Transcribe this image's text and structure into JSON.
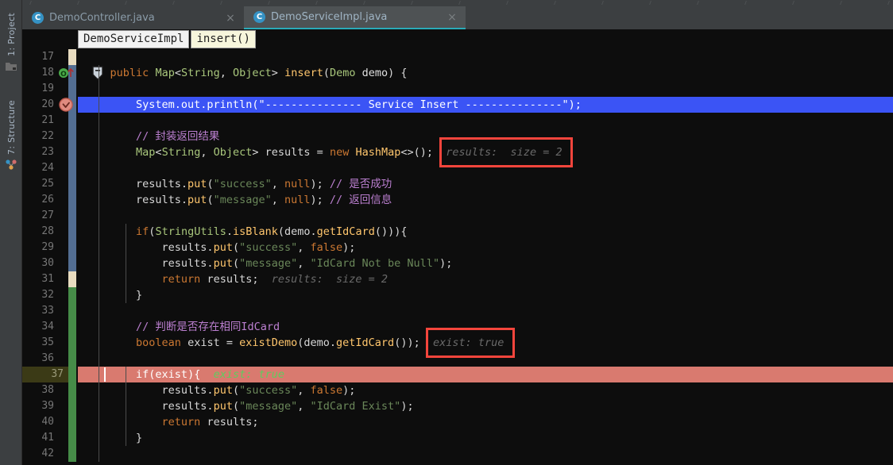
{
  "window": {
    "kind": "intellij-idea-java-editor-debug"
  },
  "sidebar": {
    "items": [
      {
        "label": "1: Project",
        "icon": "project-folder-icon"
      },
      {
        "label": "7: Structure",
        "icon": "structure-node-icon"
      }
    ]
  },
  "tabs": [
    {
      "label": "DemoController.java",
      "icon": "java-class-icon",
      "close": "×",
      "active": false
    },
    {
      "label": "DemoServiceImpl.java",
      "icon": "java-class-icon",
      "close": "×",
      "active": true
    }
  ],
  "breadcrumb": {
    "class_name": "DemoServiceImpl",
    "method_name": "insert()"
  },
  "gutter": {
    "first_line": 17,
    "last_line": 42,
    "breakpoint_line": 20,
    "override_marker_line": 18,
    "fold_marker_line": 18,
    "current_execution_line": 37,
    "breakpoint_icon": "breakpoint-verified-icon",
    "override_icon": "implements-method-icon",
    "fold_icon": "fold-collapse-icon"
  },
  "colors": {
    "selection_blue": "#3b54f5",
    "execution_salmon": "#d97a6f",
    "vcs_modified_blue": "#536e92",
    "vcs_added_green": "#468c48",
    "vcs_changed_tan": "#e8dcc0",
    "debug_box_red": "#f4453c",
    "tab_accent": "#2aabb8"
  },
  "code_lines": [
    {
      "n": 17,
      "tokens": []
    },
    {
      "n": 18,
      "tokens": [
        {
          "t": "    ",
          "c": "plain"
        },
        {
          "t": "public",
          "c": "kw"
        },
        {
          "t": " ",
          "c": "plain"
        },
        {
          "t": "Map",
          "c": "type"
        },
        {
          "t": "<",
          "c": "plain"
        },
        {
          "t": "String",
          "c": "type"
        },
        {
          "t": ", ",
          "c": "plain"
        },
        {
          "t": "Object",
          "c": "type"
        },
        {
          "t": "> ",
          "c": "plain"
        },
        {
          "t": "insert",
          "c": "mth"
        },
        {
          "t": "(",
          "c": "plain"
        },
        {
          "t": "Demo",
          "c": "type"
        },
        {
          "t": " ",
          "c": "plain"
        },
        {
          "t": "demo",
          "c": "fld"
        },
        {
          "t": ") {",
          "c": "plain"
        }
      ]
    },
    {
      "n": 19,
      "tokens": []
    },
    {
      "n": 20,
      "selected": true,
      "tokens": [
        {
          "t": "        System.out.println(\"--------------- Service Insert ---------------\");",
          "c": "sel"
        }
      ]
    },
    {
      "n": 21,
      "tokens": []
    },
    {
      "n": 22,
      "tokens": [
        {
          "t": "        ",
          "c": "plain"
        },
        {
          "t": "// 封装返回结果",
          "c": "cmt"
        }
      ]
    },
    {
      "n": 23,
      "tokens": [
        {
          "t": "        ",
          "c": "plain"
        },
        {
          "t": "Map",
          "c": "type"
        },
        {
          "t": "<",
          "c": "plain"
        },
        {
          "t": "String",
          "c": "type"
        },
        {
          "t": ", ",
          "c": "plain"
        },
        {
          "t": "Object",
          "c": "type"
        },
        {
          "t": "> results = ",
          "c": "plain"
        },
        {
          "t": "new",
          "c": "kw"
        },
        {
          "t": " ",
          "c": "plain"
        },
        {
          "t": "HashMap",
          "c": "mth"
        },
        {
          "t": "<>();",
          "c": "plain"
        }
      ],
      "inline_debug": {
        "text": "results:  size = 2",
        "boxed": true,
        "style": "gray"
      }
    },
    {
      "n": 24,
      "tokens": []
    },
    {
      "n": 25,
      "tokens": [
        {
          "t": "        results.",
          "c": "plain"
        },
        {
          "t": "put",
          "c": "mth"
        },
        {
          "t": "(",
          "c": "plain"
        },
        {
          "t": "\"success\"",
          "c": "str"
        },
        {
          "t": ", ",
          "c": "plain"
        },
        {
          "t": "null",
          "c": "kw"
        },
        {
          "t": "); ",
          "c": "plain"
        },
        {
          "t": "// 是否成功",
          "c": "cmt"
        }
      ]
    },
    {
      "n": 26,
      "tokens": [
        {
          "t": "        results.",
          "c": "plain"
        },
        {
          "t": "put",
          "c": "mth"
        },
        {
          "t": "(",
          "c": "plain"
        },
        {
          "t": "\"message\"",
          "c": "str"
        },
        {
          "t": ", ",
          "c": "plain"
        },
        {
          "t": "null",
          "c": "kw"
        },
        {
          "t": "); ",
          "c": "plain"
        },
        {
          "t": "// 返回信息",
          "c": "cmt"
        }
      ]
    },
    {
      "n": 27,
      "tokens": []
    },
    {
      "n": 28,
      "tokens": [
        {
          "t": "        ",
          "c": "plain"
        },
        {
          "t": "if",
          "c": "kw"
        },
        {
          "t": "(",
          "c": "plain"
        },
        {
          "t": "StringUtils",
          "c": "type"
        },
        {
          "t": ".",
          "c": "plain"
        },
        {
          "t": "isBlank",
          "c": "mth"
        },
        {
          "t": "(demo.",
          "c": "plain"
        },
        {
          "t": "getIdCard",
          "c": "mth"
        },
        {
          "t": "())){",
          "c": "plain"
        }
      ]
    },
    {
      "n": 29,
      "tokens": [
        {
          "t": "            results.",
          "c": "plain"
        },
        {
          "t": "put",
          "c": "mth"
        },
        {
          "t": "(",
          "c": "plain"
        },
        {
          "t": "\"success\"",
          "c": "str"
        },
        {
          "t": ", ",
          "c": "plain"
        },
        {
          "t": "false",
          "c": "kw"
        },
        {
          "t": ");",
          "c": "plain"
        }
      ]
    },
    {
      "n": 30,
      "tokens": [
        {
          "t": "            results.",
          "c": "plain"
        },
        {
          "t": "put",
          "c": "mth"
        },
        {
          "t": "(",
          "c": "plain"
        },
        {
          "t": "\"message\"",
          "c": "str"
        },
        {
          "t": ", ",
          "c": "plain"
        },
        {
          "t": "\"IdCard Not be Null\"",
          "c": "str"
        },
        {
          "t": ");",
          "c": "plain"
        }
      ]
    },
    {
      "n": 31,
      "tokens": [
        {
          "t": "            ",
          "c": "plain"
        },
        {
          "t": "return",
          "c": "kw"
        },
        {
          "t": " results;",
          "c": "plain"
        }
      ],
      "inline_debug": {
        "text": "results:  size = 2",
        "boxed": false,
        "style": "gray"
      }
    },
    {
      "n": 32,
      "tokens": [
        {
          "t": "        }",
          "c": "plain"
        }
      ]
    },
    {
      "n": 33,
      "tokens": []
    },
    {
      "n": 34,
      "tokens": [
        {
          "t": "        ",
          "c": "plain"
        },
        {
          "t": "// 判断是否存在相同IdCard",
          "c": "cmt"
        }
      ]
    },
    {
      "n": 35,
      "tokens": [
        {
          "t": "        ",
          "c": "plain"
        },
        {
          "t": "boolean",
          "c": "kw"
        },
        {
          "t": " exist = ",
          "c": "plain"
        },
        {
          "t": "existDemo",
          "c": "mth"
        },
        {
          "t": "(demo.",
          "c": "plain"
        },
        {
          "t": "getIdCard",
          "c": "mth"
        },
        {
          "t": "());",
          "c": "plain"
        }
      ],
      "inline_debug": {
        "text": "exist: true",
        "boxed": true,
        "style": "gray"
      }
    },
    {
      "n": 36,
      "tokens": []
    },
    {
      "n": 37,
      "executing": true,
      "tokens": [
        {
          "t": "        ",
          "c": "plain"
        },
        {
          "t": "if",
          "c": "sel"
        },
        {
          "t": "(exist){",
          "c": "sel"
        }
      ],
      "inline_debug": {
        "text": "exist: true",
        "boxed": false,
        "style": "green"
      }
    },
    {
      "n": 38,
      "tokens": [
        {
          "t": "            results.",
          "c": "plain"
        },
        {
          "t": "put",
          "c": "mth"
        },
        {
          "t": "(",
          "c": "plain"
        },
        {
          "t": "\"success\"",
          "c": "str"
        },
        {
          "t": ", ",
          "c": "plain"
        },
        {
          "t": "false",
          "c": "kw"
        },
        {
          "t": ");",
          "c": "plain"
        }
      ]
    },
    {
      "n": 39,
      "tokens": [
        {
          "t": "            results.",
          "c": "plain"
        },
        {
          "t": "put",
          "c": "mth"
        },
        {
          "t": "(",
          "c": "plain"
        },
        {
          "t": "\"message\"",
          "c": "str"
        },
        {
          "t": ", ",
          "c": "plain"
        },
        {
          "t": "\"IdCard Exist\"",
          "c": "str"
        },
        {
          "t": ");",
          "c": "plain"
        }
      ]
    },
    {
      "n": 40,
      "tokens": [
        {
          "t": "            ",
          "c": "plain"
        },
        {
          "t": "return",
          "c": "kw"
        },
        {
          "t": " results;",
          "c": "plain"
        }
      ]
    },
    {
      "n": 41,
      "tokens": [
        {
          "t": "        }",
          "c": "plain"
        }
      ]
    },
    {
      "n": 42,
      "tokens": []
    }
  ]
}
